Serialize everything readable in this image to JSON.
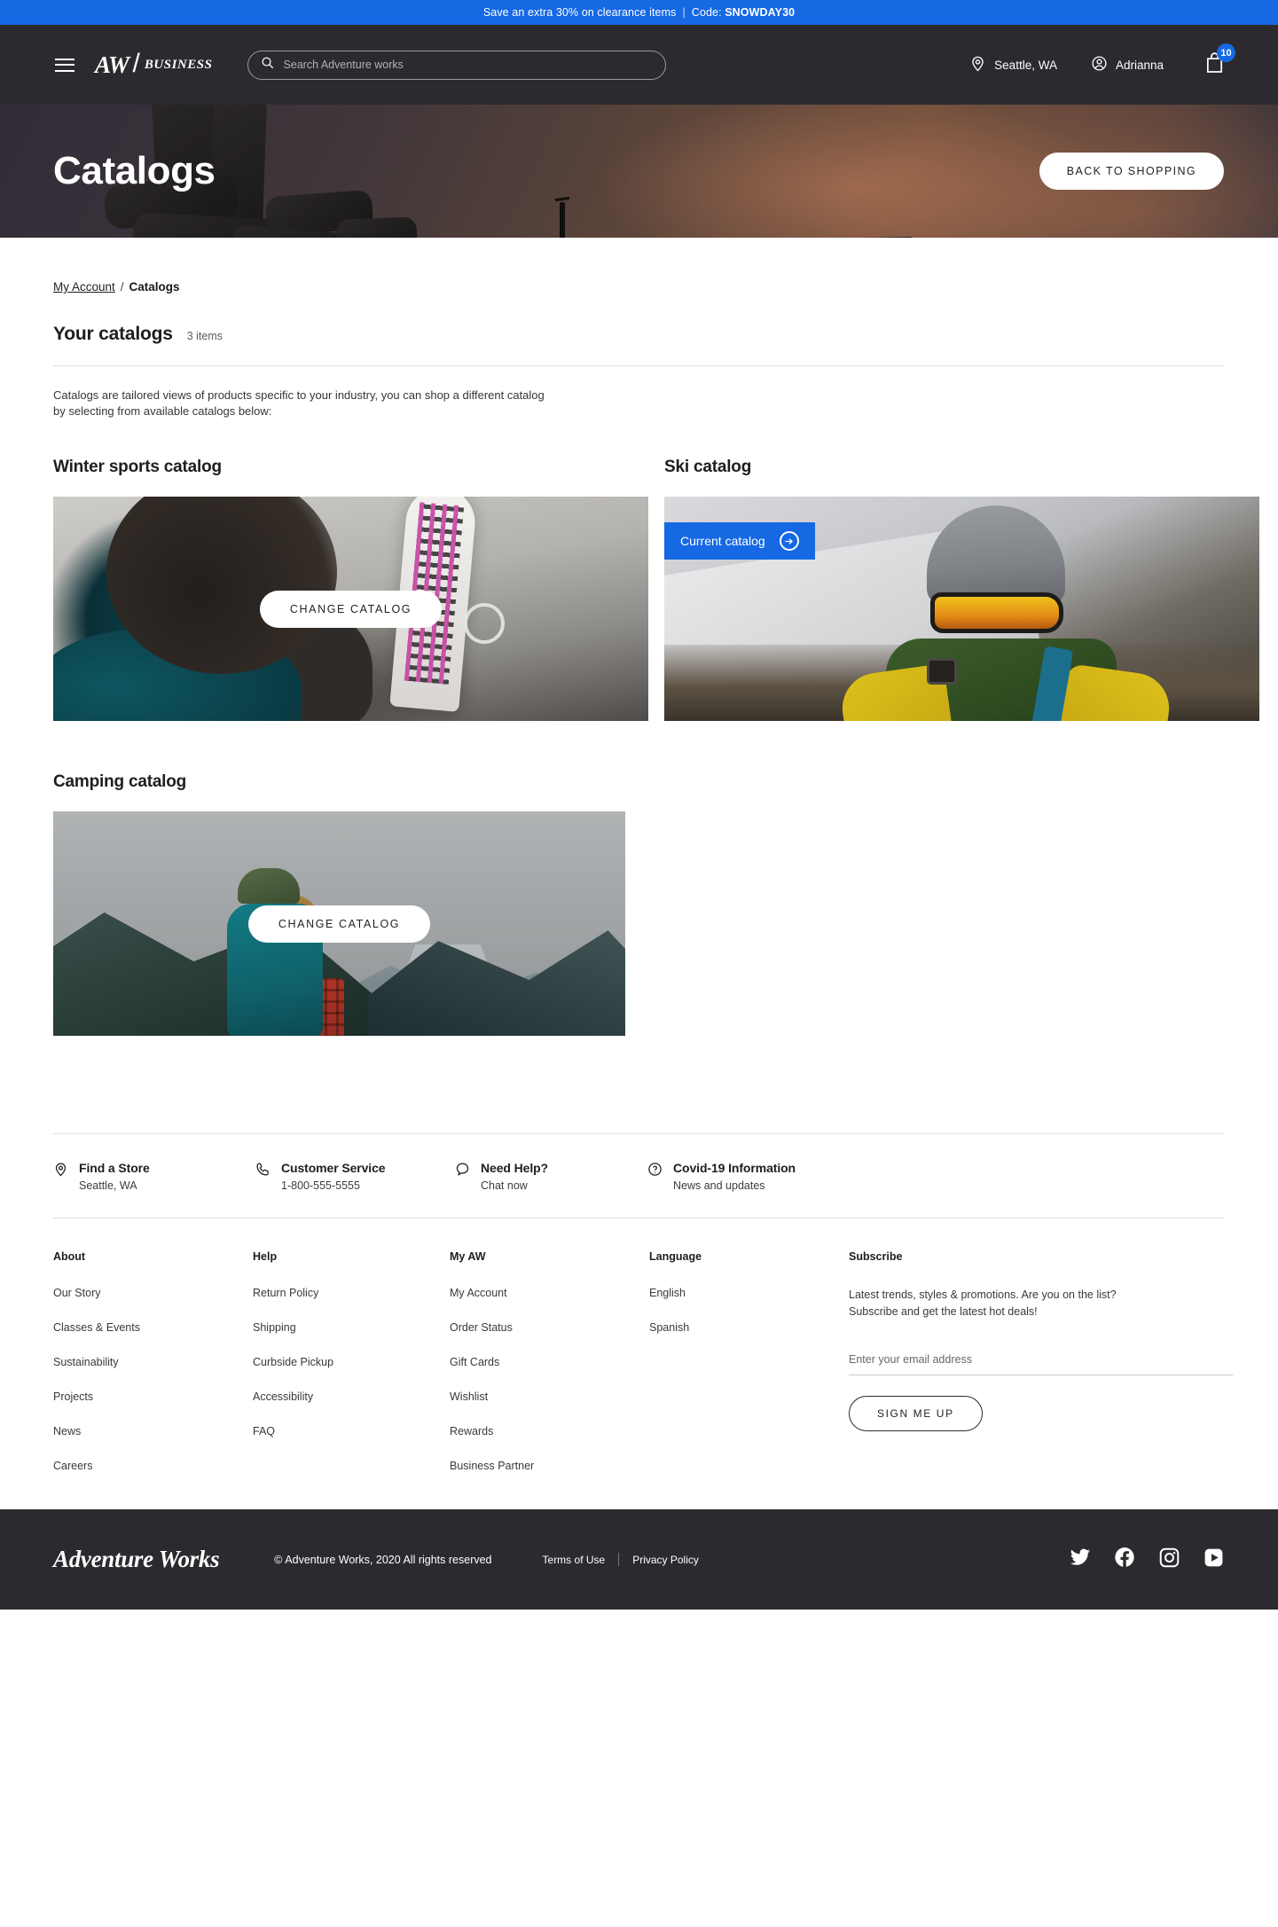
{
  "promo": {
    "text": "Save an extra 30% on clearance items",
    "separator": "|",
    "code_label": "Code:",
    "code": "SNOWDAY30"
  },
  "header": {
    "menu_icon": "hamburger-menu-icon",
    "brand_main": "AW",
    "brand_divider": "/",
    "brand_sub": "BUSINESS",
    "search_placeholder": "Search Adventure works",
    "search_value": "",
    "location": "Seattle, WA",
    "account": "Adrianna",
    "cart_count": "10"
  },
  "hero": {
    "title": "Catalogs",
    "cta": "BACK TO SHOPPING"
  },
  "breadcrumb": {
    "parent": "My Account",
    "separator": "/",
    "current": "Catalogs"
  },
  "section": {
    "title": "Your catalogs",
    "count": "3 items",
    "intro": "Catalogs are tailored views of products specific to your industry, you can shop a different catalog by selecting from available catalogs below:"
  },
  "catalogs": [
    {
      "title": "Winter sports catalog",
      "button": "CHANGE CATALOG",
      "is_current": false
    },
    {
      "title": "Ski catalog",
      "badge": "Current catalog",
      "is_current": true
    },
    {
      "title": "Camping catalog",
      "button": "CHANGE CATALOG",
      "is_current": false
    }
  ],
  "services": [
    {
      "icon": "location-pin-icon",
      "title": "Find a Store",
      "sub": "Seattle, WA"
    },
    {
      "icon": "phone-icon",
      "title": "Customer Service",
      "sub": "1-800-555-5555"
    },
    {
      "icon": "chat-bubble-icon",
      "title": "Need Help?",
      "sub": "Chat now"
    },
    {
      "icon": "question-circle-icon",
      "title": "Covid-19 Information",
      "sub": "News and updates"
    }
  ],
  "footer_columns": [
    {
      "head": "About",
      "links": [
        "Our Story",
        "Classes & Events",
        "Sustainability",
        "Projects",
        "News",
        "Careers"
      ]
    },
    {
      "head": "Help",
      "links": [
        "Return Policy",
        "Shipping",
        "Curbside Pickup",
        "Accessibility",
        "FAQ"
      ]
    },
    {
      "head": "My AW",
      "links": [
        "My Account",
        "Order Status",
        "Gift Cards",
        "Wishlist",
        "Rewards",
        "Business Partner"
      ]
    },
    {
      "head": "Language",
      "links": [
        "English",
        "Spanish"
      ]
    }
  ],
  "subscribe": {
    "head": "Subscribe",
    "line1": "Latest trends, styles & promotions. Are you on the list?",
    "line2": "Subscribe and get the latest hot deals!",
    "email_placeholder": "Enter your email address",
    "email_value": "",
    "button": "SIGN ME UP"
  },
  "bottom": {
    "logo": "Adventure Works",
    "copyright": "© Adventure Works, 2020 All rights reserved",
    "terms": "Terms of Use",
    "privacy": "Privacy Policy",
    "socials": [
      "twitter-icon",
      "facebook-icon",
      "instagram-icon",
      "youtube-icon"
    ]
  },
  "colors": {
    "accent": "#1668e3",
    "dark": "#2c2a2e",
    "text": "#231f20"
  }
}
